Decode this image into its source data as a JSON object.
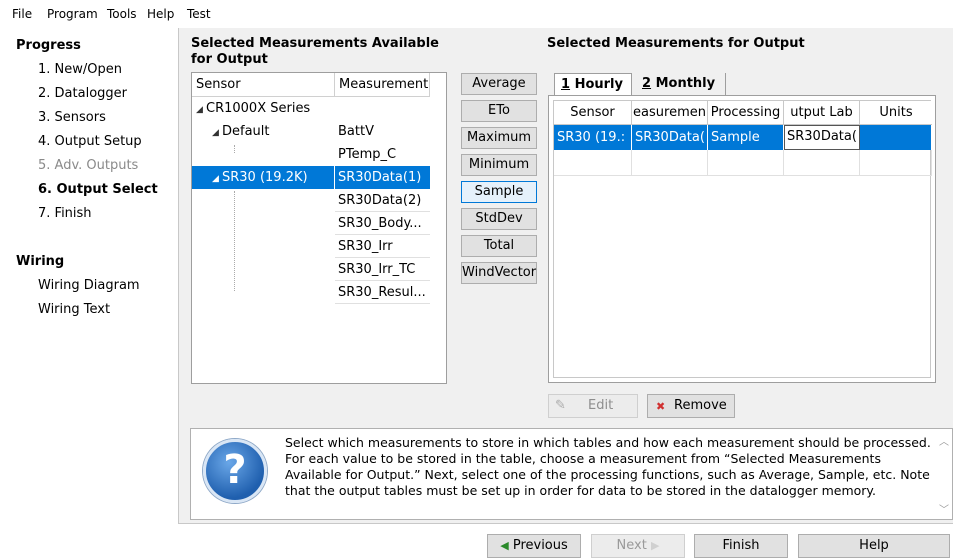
{
  "menu": [
    "File",
    "Program",
    "Tools",
    "Help",
    "Test"
  ],
  "nav": {
    "progress_header": "Progress",
    "steps": [
      {
        "label": "1. New/Open",
        "state": "normal"
      },
      {
        "label": "2. Datalogger",
        "state": "normal"
      },
      {
        "label": "3. Sensors",
        "state": "normal"
      },
      {
        "label": "4. Output Setup",
        "state": "normal"
      },
      {
        "label": "5. Adv. Outputs",
        "state": "disabled"
      },
      {
        "label": "6. Output Select",
        "state": "current"
      },
      {
        "label": "7. Finish",
        "state": "normal"
      }
    ],
    "wiring_header": "Wiring",
    "wiring_items": [
      "Wiring Diagram",
      "Wiring Text"
    ]
  },
  "available": {
    "title": "Selected Measurements Available for Output",
    "col_sensor": "Sensor",
    "col_measurement": "Measurement",
    "rows": [
      {
        "sensor": "CR1000X Series",
        "measurement": "",
        "expander": "◢"
      },
      {
        "sensor": "Default",
        "measurement": "BattV",
        "expander": "◢"
      },
      {
        "sensor": "",
        "measurement": "PTemp_C",
        "expander": ""
      },
      {
        "sensor": "SR30 (19.2K)",
        "measurement": "SR30Data(1)",
        "expander": "◢",
        "selected": true
      },
      {
        "sensor": "",
        "measurement": "SR30Data(2)",
        "expander": ""
      },
      {
        "sensor": "",
        "measurement": "SR30_Body...",
        "expander": ""
      },
      {
        "sensor": "",
        "measurement": "SR30_Irr",
        "expander": ""
      },
      {
        "sensor": "",
        "measurement": "SR30_Irr_TC",
        "expander": ""
      },
      {
        "sensor": "",
        "measurement": "SR30_Resul...",
        "expander": ""
      }
    ]
  },
  "processing_buttons": [
    "Average",
    "ETo",
    "Maximum",
    "Minimum",
    "Sample",
    "StdDev",
    "Total",
    "WindVector"
  ],
  "active_processing": "Sample",
  "output": {
    "title": "Selected Measurements for Output",
    "tabs": [
      {
        "key": "1",
        "label": " Hourly"
      },
      {
        "key": "2",
        "label": " Monthly"
      }
    ],
    "columns": [
      "Sensor",
      "easuremen",
      "Processing",
      "utput Lab",
      "Units"
    ],
    "row": {
      "sensor": "SR30 (19.:",
      "measurement": "SR30Data(",
      "processing": "Sample",
      "output_label": "SR30Data(",
      "units": ""
    }
  },
  "edit_label": "Edit",
  "remove_label": "Remove",
  "help_text": "Select which measurements to store in which tables and how each measurement should be processed. For each value to be stored in the table, choose a measurement from “Selected Measurements Available for Output.”  Next, select one of the processing functions, such as Average, Sample, etc. Note that the output tables must be set up in order for data to be stored in the datalogger memory.",
  "footer": {
    "previous": "Previous",
    "next": "Next",
    "finish": "Finish",
    "help": "Help"
  },
  "colors": {
    "selection": "#0078d7",
    "help_icon": "#1f5fae"
  }
}
